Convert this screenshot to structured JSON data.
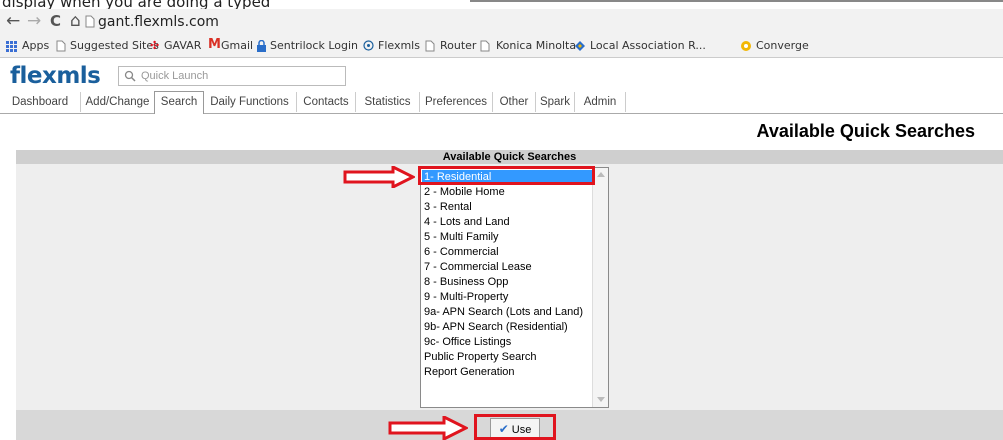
{
  "caption_fragment": "display when you are doing a typed",
  "browser": {
    "back_glyph": "←",
    "forward_glyph": "→",
    "reload_glyph": "C",
    "home_glyph": "⌂",
    "url": "gant.flexmls.com"
  },
  "bookmarks": [
    "Apps",
    "Suggested Sites",
    "GAVAR",
    "Gmail",
    "Sentrilock Login",
    "Flexmls",
    "Router",
    "Konica Minolta",
    "Local Association R...",
    "Converge"
  ],
  "app": {
    "logo": "flexmls",
    "quick_launch_placeholder": "Quick Launch"
  },
  "tabs": [
    "Dashboard",
    "Add/Change",
    "Search",
    "Daily Functions",
    "Contacts",
    "Statistics",
    "Preferences",
    "Other",
    "Spark",
    "Admin"
  ],
  "active_tab": "Search",
  "page_title": "Available Quick Searches",
  "panel": {
    "header": "Available Quick Searches",
    "options": [
      "1- Residential",
      "2 - Mobile Home",
      "3 - Rental",
      "4 - Lots and Land",
      "5 - Multi Family",
      "6 - Commercial",
      "7 - Commercial Lease",
      "8 - Business Opp",
      "9 - Multi-Property",
      "9a- APN Search (Lots and Land)",
      "9b- APN Search (Residential)",
      "9c- Office Listings",
      "Public Property Search",
      "Report Generation"
    ],
    "selected": "1- Residential",
    "use_label": "Use"
  },
  "colors": {
    "annotation": "#e0141e",
    "selection": "#3399ff",
    "logo": "#1a5f9c"
  }
}
